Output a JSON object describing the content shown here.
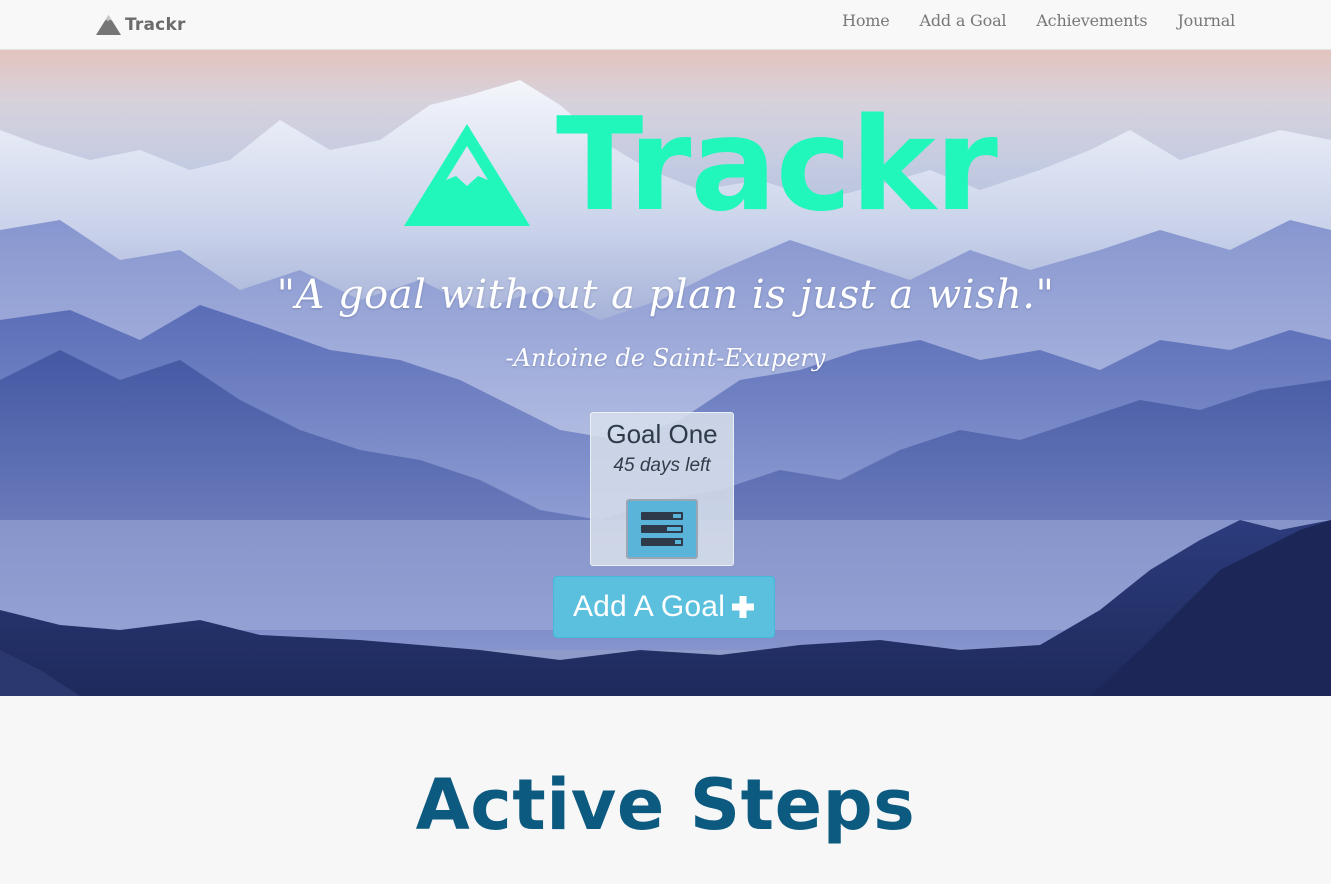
{
  "navbar": {
    "brand": "Trackr",
    "links": [
      {
        "label": "Home"
      },
      {
        "label": "Add a Goal"
      },
      {
        "label": "Achievements"
      },
      {
        "label": "Journal"
      }
    ]
  },
  "hero": {
    "logo_text": "Trackr",
    "quote": "\"A goal without a plan is just a wish.\"",
    "quote_author": "-Antoine de Saint-Exupery",
    "goal_card": {
      "title": "Goal One",
      "days_left": "45 days left",
      "button_icon": "tasks-icon"
    },
    "add_goal_button": {
      "label": "Add A Goal",
      "icon": "plus-icon"
    }
  },
  "section": {
    "title": "Active Steps"
  },
  "colors": {
    "accent": "#22f7bb",
    "info_button": "#5bc0de",
    "section_title": "#0d5a80",
    "navbar_bg": "#f8f8f8"
  }
}
